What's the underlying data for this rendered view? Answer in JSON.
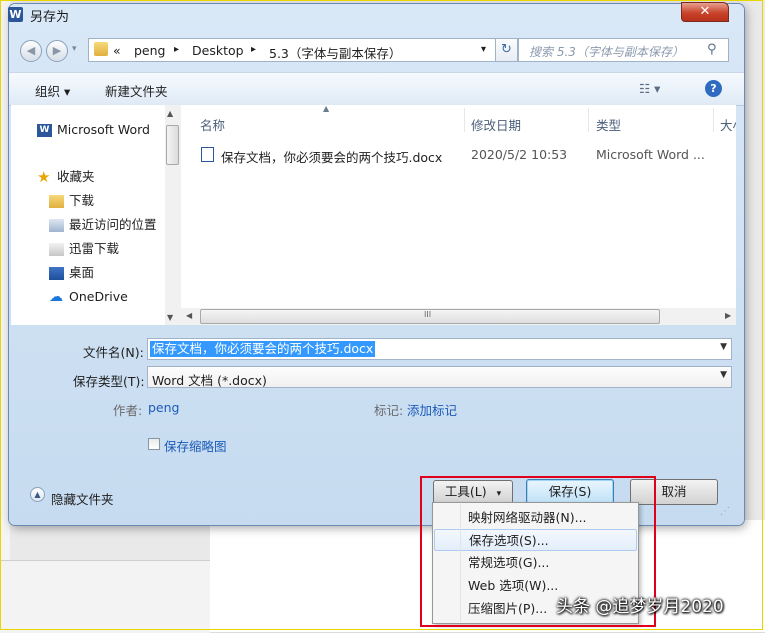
{
  "dialog": {
    "title": "另存为",
    "app_icon_letter": "W",
    "close_glyph": "✕"
  },
  "navigation": {
    "back_glyph": "◀",
    "forward_glyph": "▶",
    "path_overflow": "«",
    "breadcrumbs": [
      "peng",
      "Desktop",
      "5.3（字体与副本保存）"
    ],
    "separator": "▸",
    "address_dropdown": "▾",
    "refresh_glyph": "↻",
    "search_placeholder": "搜索 5.3（字体与副本保存）",
    "search_glyph": "⚲"
  },
  "toolbar": {
    "organize": "组织 ▾",
    "new_folder": "新建文件夹",
    "view_glyph": "☷ ▾",
    "help_glyph": "?"
  },
  "nav_pane": {
    "items": [
      {
        "label": "Microsoft Word",
        "icon": "word-icon"
      },
      {
        "label": "收藏夹",
        "icon": "star-icon"
      },
      {
        "label": "下载",
        "icon": "download-folder-icon"
      },
      {
        "label": "最近访问的位置",
        "icon": "recent-places-icon"
      },
      {
        "label": "迅雷下载",
        "icon": "thunder-folder-icon"
      },
      {
        "label": "桌面",
        "icon": "desktop-icon"
      },
      {
        "label": "OneDrive",
        "icon": "cloud-icon"
      }
    ]
  },
  "file_list": {
    "columns": [
      "名称",
      "修改日期",
      "类型",
      "大小"
    ],
    "rows": [
      {
        "name": "保存文档，你必须要会的两个技巧.docx",
        "modified": "2020/5/2 10:53",
        "type": "Microsoft Word ..."
      }
    ],
    "hscroll_grip": "III"
  },
  "form": {
    "filename_label": "文件名(N):",
    "filename_value": "保存文档，你必须要会的两个技巧.docx",
    "filetype_label": "保存类型(T):",
    "filetype_value": "Word 文档 (*.docx)",
    "author_label": "作者:",
    "author_value": "peng",
    "tags_label": "标记:",
    "tags_value": "添加标记",
    "thumbnail_label": "保存缩略图",
    "thumbnail_checked": false
  },
  "footer": {
    "hide_folders": "隐藏文件夹",
    "tools": "工具(L)",
    "tools_arrow": "▾",
    "save": "保存(S)",
    "cancel": "取消"
  },
  "tools_menu": {
    "items": [
      {
        "label": "映射网络驱动器(N)...",
        "highlighted": false
      },
      {
        "label": "保存选项(S)...",
        "highlighted": true
      },
      {
        "label": "常规选项(G)...",
        "highlighted": false
      },
      {
        "label": "Web 选项(W)...",
        "highlighted": false
      },
      {
        "label": "压缩图片(P)...",
        "highlighted": false
      }
    ]
  },
  "watermark": "头条 @追梦岁月2020",
  "colors": {
    "highlight_box": "#e0001a",
    "selection": "#3399ff",
    "link": "#1c5bb8"
  }
}
